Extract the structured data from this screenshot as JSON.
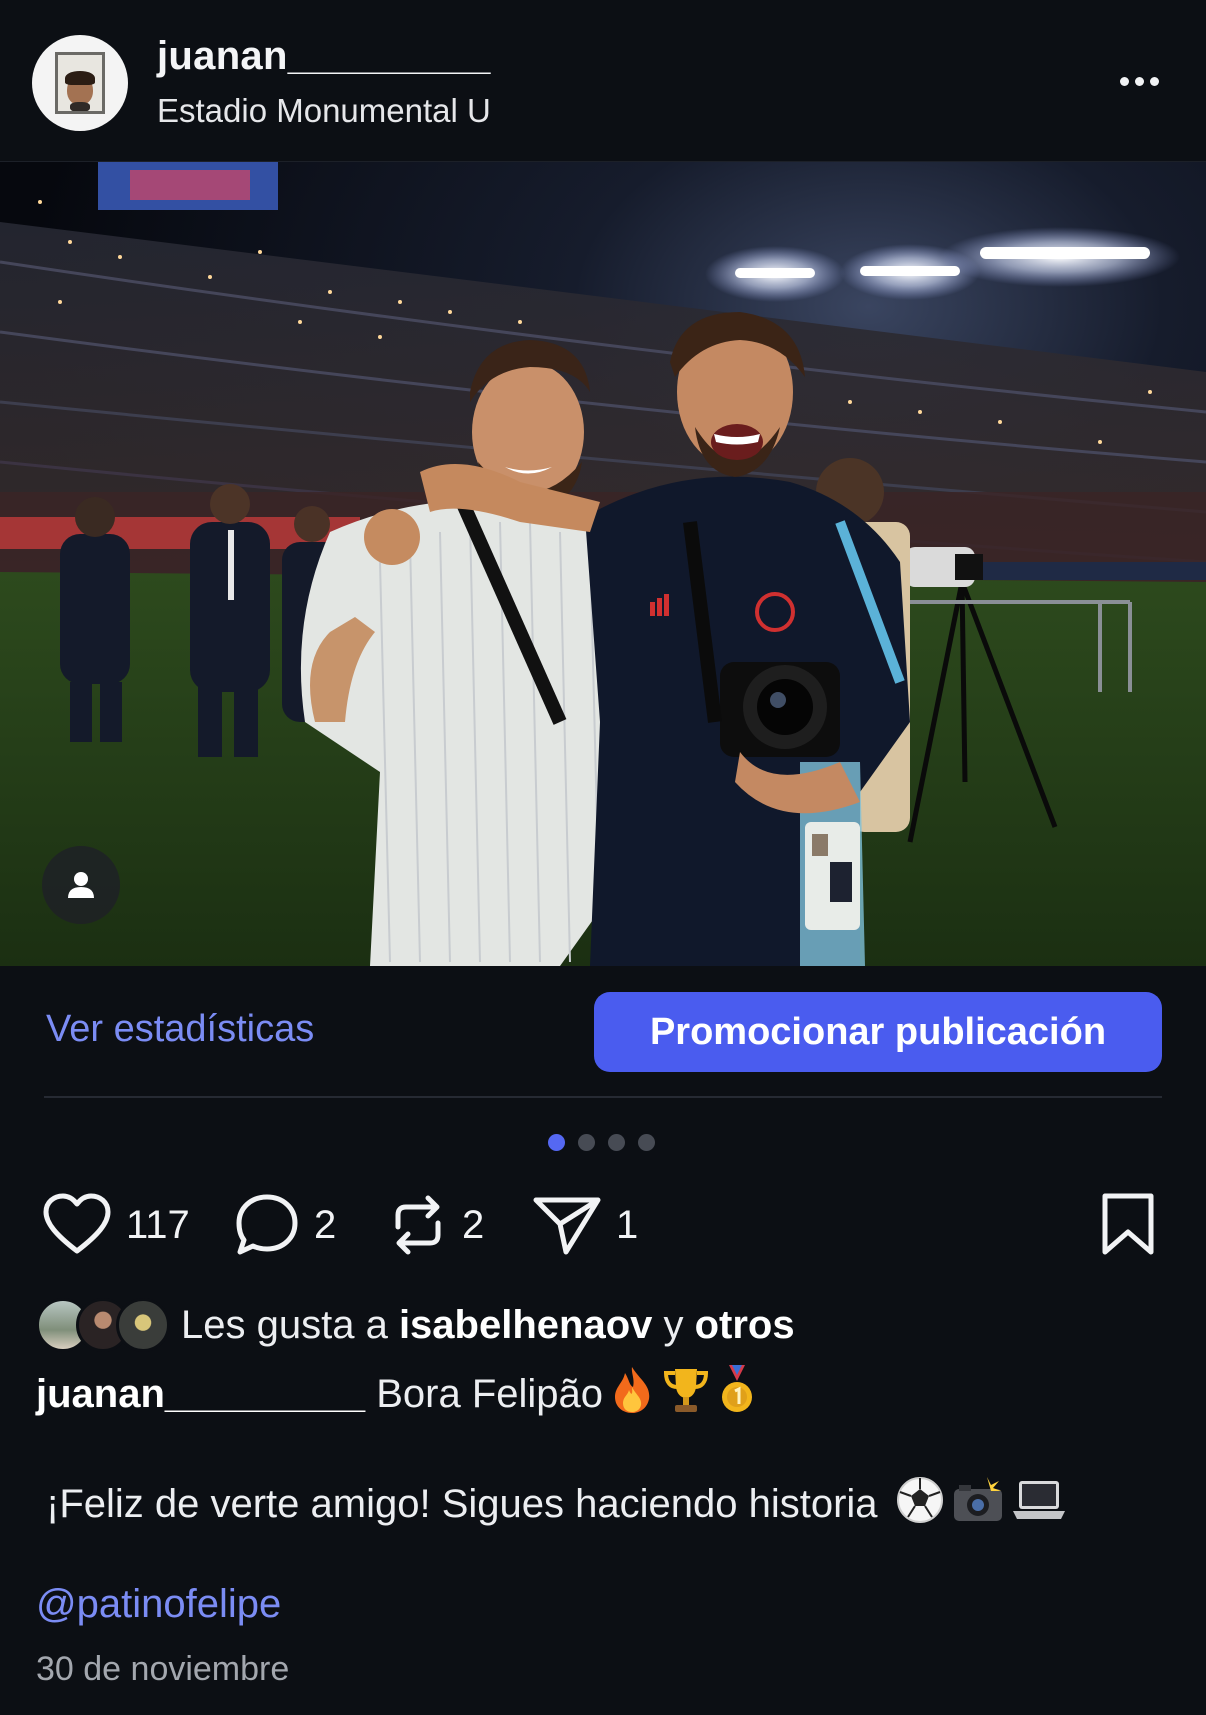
{
  "post": {
    "username": "juanan_________",
    "location": "Estadio Monumental U"
  },
  "icons": {
    "more": "more-horizontal-icon",
    "tag": "user-tag-icon",
    "like": "heart-icon",
    "comment": "comment-bubble-icon",
    "repost": "repost-icon",
    "share": "send-icon",
    "save": "bookmark-icon"
  },
  "actions": {
    "stats_label": "Ver estadísticas",
    "promote_label": "Promocionar publicación"
  },
  "carousel": {
    "total": 4,
    "active_index": 0
  },
  "engagement": {
    "likes": "117",
    "comments": "2",
    "reposts": "2",
    "shares": "1"
  },
  "likes_summary": {
    "prefix": "Les gusta a ",
    "user": "isabelhenaov",
    "middle": " y ",
    "others": "otros"
  },
  "caption": {
    "username": "juanan_________",
    "line1": " Bora Felipão",
    "line2": "¡Feliz de verte amigo! Sigues haciendo historia",
    "mention": "@patinofelipe"
  },
  "date": "30 de noviembre",
  "colors": {
    "background": "#0c0f14",
    "accent": "#4a5cef",
    "link": "#7b8cf4"
  }
}
